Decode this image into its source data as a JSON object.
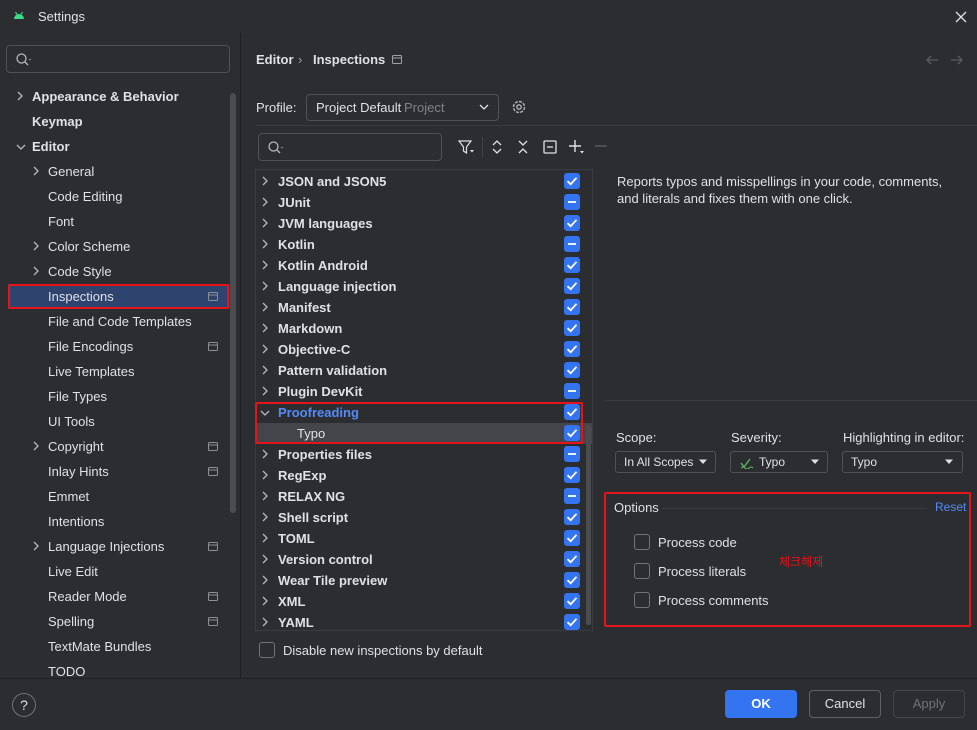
{
  "window": {
    "title": "Settings"
  },
  "sidebar": {
    "search_placeholder": "",
    "items": [
      {
        "label": "Appearance & Behavior",
        "expandable": true,
        "expanded": false,
        "level": 0,
        "bold": true
      },
      {
        "label": "Keymap",
        "expandable": false,
        "level": 0,
        "bold": true
      },
      {
        "label": "Editor",
        "expandable": true,
        "expanded": true,
        "level": 0,
        "bold": true
      },
      {
        "label": "General",
        "expandable": true,
        "expanded": false,
        "level": 1
      },
      {
        "label": "Code Editing",
        "expandable": false,
        "level": 1
      },
      {
        "label": "Font",
        "expandable": false,
        "level": 1
      },
      {
        "label": "Color Scheme",
        "expandable": true,
        "expanded": false,
        "level": 1
      },
      {
        "label": "Code Style",
        "expandable": true,
        "expanded": false,
        "level": 1
      },
      {
        "label": "Inspections",
        "expandable": false,
        "level": 1,
        "selected": true,
        "project_icon": true
      },
      {
        "label": "File and Code Templates",
        "expandable": false,
        "level": 1
      },
      {
        "label": "File Encodings",
        "expandable": false,
        "level": 1,
        "project_icon": true
      },
      {
        "label": "Live Templates",
        "expandable": false,
        "level": 1
      },
      {
        "label": "File Types",
        "expandable": false,
        "level": 1
      },
      {
        "label": "UI Tools",
        "expandable": false,
        "level": 1
      },
      {
        "label": "Copyright",
        "expandable": true,
        "expanded": false,
        "level": 1,
        "project_icon": true
      },
      {
        "label": "Inlay Hints",
        "expandable": false,
        "level": 1,
        "project_icon": true
      },
      {
        "label": "Emmet",
        "expandable": false,
        "level": 1
      },
      {
        "label": "Intentions",
        "expandable": false,
        "level": 1
      },
      {
        "label": "Language Injections",
        "expandable": true,
        "expanded": false,
        "level": 1,
        "project_icon": true
      },
      {
        "label": "Live Edit",
        "expandable": false,
        "level": 1
      },
      {
        "label": "Reader Mode",
        "expandable": false,
        "level": 1,
        "project_icon": true
      },
      {
        "label": "Spelling",
        "expandable": false,
        "level": 1,
        "project_icon": true
      },
      {
        "label": "TextMate Bundles",
        "expandable": false,
        "level": 1
      },
      {
        "label": "TODO",
        "expandable": false,
        "level": 1
      }
    ]
  },
  "breadcrumb": {
    "parent": "Editor",
    "separator": "›",
    "current": "Inspections"
  },
  "profile": {
    "label": "Profile:",
    "value": "Project Default",
    "sub": "Project"
  },
  "inspections": {
    "search_placeholder": "",
    "items": [
      {
        "label": "JSON and JSON5",
        "state": "checked"
      },
      {
        "label": "JUnit",
        "state": "partial"
      },
      {
        "label": "JVM languages",
        "state": "checked"
      },
      {
        "label": "Kotlin",
        "state": "partial"
      },
      {
        "label": "Kotlin Android",
        "state": "checked"
      },
      {
        "label": "Language injection",
        "state": "checked"
      },
      {
        "label": "Manifest",
        "state": "checked"
      },
      {
        "label": "Markdown",
        "state": "checked"
      },
      {
        "label": "Objective-C",
        "state": "checked"
      },
      {
        "label": "Pattern validation",
        "state": "checked"
      },
      {
        "label": "Plugin DevKit",
        "state": "partial"
      },
      {
        "label": "Proofreading",
        "state": "checked",
        "expanded": true,
        "highlight": true
      },
      {
        "label": "Typo",
        "state": "checked",
        "child": true,
        "selected": true
      },
      {
        "label": "Properties files",
        "state": "partial"
      },
      {
        "label": "RegExp",
        "state": "checked"
      },
      {
        "label": "RELAX NG",
        "state": "partial"
      },
      {
        "label": "Shell script",
        "state": "checked"
      },
      {
        "label": "TOML",
        "state": "checked"
      },
      {
        "label": "Version control",
        "state": "checked"
      },
      {
        "label": "Wear Tile preview",
        "state": "checked"
      },
      {
        "label": "XML",
        "state": "checked"
      },
      {
        "label": "YAML",
        "state": "checked"
      }
    ]
  },
  "description": "Reports typos and misspellings in your code, comments, and literals and fixes them with one click.",
  "settings": {
    "scope_label": "Scope:",
    "scope_value": "In All Scopes",
    "severity_label": "Severity:",
    "severity_value": "Typo",
    "highlight_label": "Highlighting in editor:",
    "highlight_value": "Typo"
  },
  "options": {
    "title": "Options",
    "reset": "Reset",
    "items": [
      {
        "label": "Process code",
        "checked": false
      },
      {
        "label": "Process literals",
        "checked": false
      },
      {
        "label": "Process comments",
        "checked": false
      }
    ],
    "annotation": "체크해제"
  },
  "disable_new": {
    "label": "Disable new inspections by default",
    "checked": false
  },
  "buttons": {
    "help": "?",
    "ok": "OK",
    "cancel": "Cancel",
    "apply": "Apply"
  },
  "colors": {
    "accent": "#3574f0",
    "selection": "#2e436e",
    "annotation_red": "#e5141b",
    "link": "#548af7"
  }
}
